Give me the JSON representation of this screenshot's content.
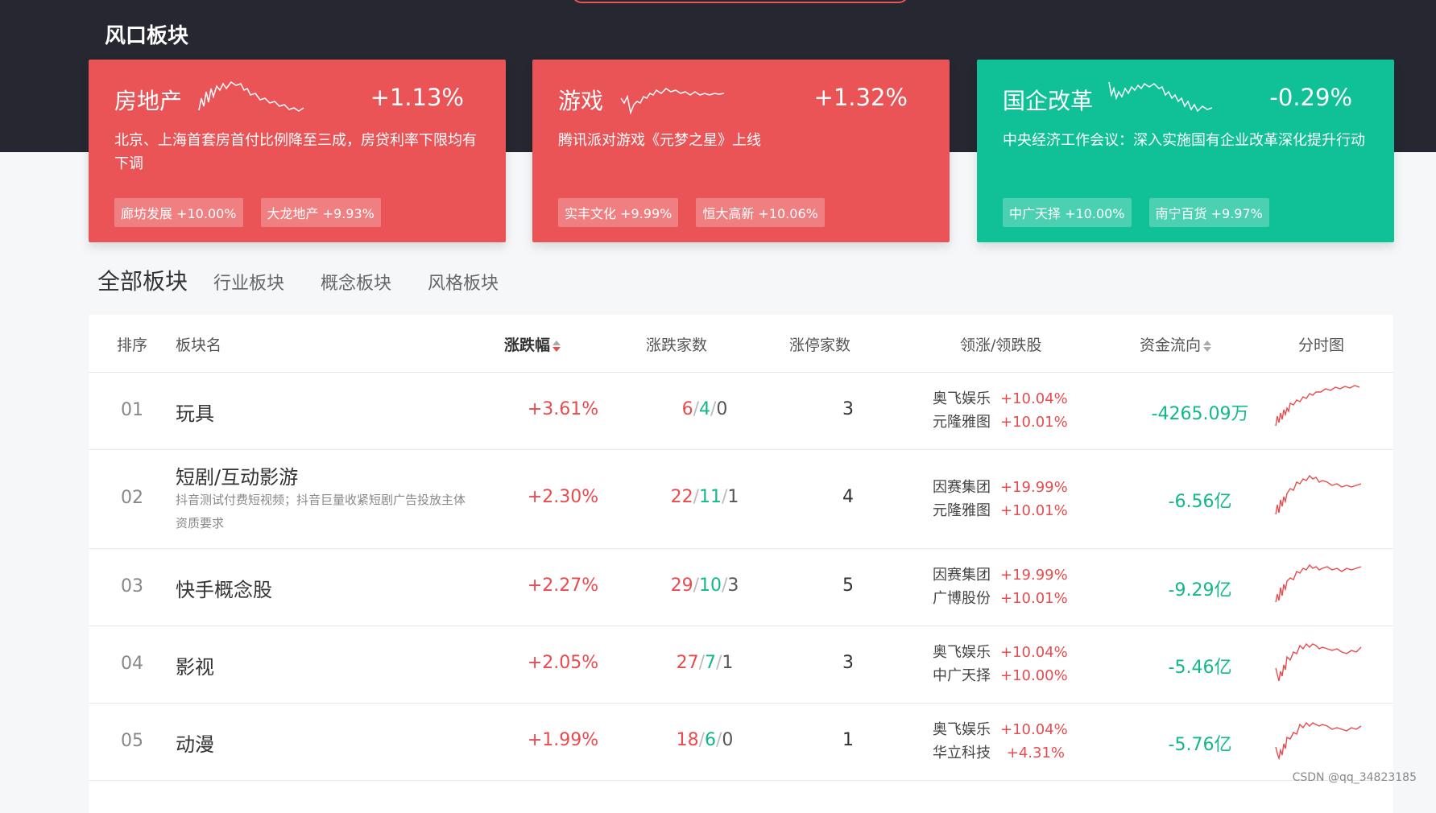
{
  "header": {
    "title": "风口板块"
  },
  "cards": [
    {
      "name": "房地产",
      "pct": "+1.13%",
      "desc": "北京、上海首套房首付比例降至三成，房贷利率下限均有下调",
      "tags": [
        "廊坊发展 +10.00%",
        "大龙地产 +9.93%"
      ],
      "color": "#ea5456"
    },
    {
      "name": "游戏",
      "pct": "+1.32%",
      "desc": "腾讯派对游戏《元梦之星》上线",
      "tags": [
        "实丰文化 +9.99%",
        "恒大高新 +10.06%"
      ],
      "color": "#ea5456"
    },
    {
      "name": "国企改革",
      "pct": "-0.29%",
      "desc": "中央经济工作会议：深入实施国有企业改革深化提升行动",
      "tags": [
        "中广天择 +10.00%",
        "南宁百货 +9.97%"
      ],
      "color": "#10c198"
    }
  ],
  "tabs": [
    "全部板块",
    "行业板块",
    "概念板块",
    "风格板块"
  ],
  "table": {
    "headers": {
      "rank": "排序",
      "name": "板块名",
      "chg": "涨跌幅",
      "ud": "涨跌家数",
      "zt": "涨停家数",
      "lead": "领涨/领跌股",
      "flow": "资金流向",
      "chart": "分时图"
    },
    "rows": [
      {
        "rank": "01",
        "name": "玩具",
        "sub": "",
        "chg": "+3.61%",
        "up": "6",
        "down": "4",
        "flat": "0",
        "zt": "3",
        "lead": [
          {
            "n": "奥飞娱乐",
            "p": "+10.04%"
          },
          {
            "n": "元隆雅图",
            "p": "+10.01%"
          }
        ],
        "flow": "-4265.09万"
      },
      {
        "rank": "02",
        "name": "短剧/互动影游",
        "sub": "抖音测试付费短视频；抖音巨量收紧短剧广告投放主体资质要求",
        "chg": "+2.30%",
        "up": "22",
        "down": "11",
        "flat": "1",
        "zt": "4",
        "lead": [
          {
            "n": "因赛集团",
            "p": "+19.99%"
          },
          {
            "n": "元隆雅图",
            "p": "+10.01%"
          }
        ],
        "flow": "-6.56亿"
      },
      {
        "rank": "03",
        "name": "快手概念股",
        "sub": "",
        "chg": "+2.27%",
        "up": "29",
        "down": "10",
        "flat": "3",
        "zt": "5",
        "lead": [
          {
            "n": "因赛集团",
            "p": "+19.99%"
          },
          {
            "n": "广博股份",
            "p": "+10.01%"
          }
        ],
        "flow": "-9.29亿"
      },
      {
        "rank": "04",
        "name": "影视",
        "sub": "",
        "chg": "+2.05%",
        "up": "27",
        "down": "7",
        "flat": "1",
        "zt": "3",
        "lead": [
          {
            "n": "奥飞娱乐",
            "p": "+10.04%"
          },
          {
            "n": "中广天择",
            "p": "+10.00%"
          }
        ],
        "flow": "-5.46亿"
      },
      {
        "rank": "05",
        "name": "动漫",
        "sub": "",
        "chg": "+1.99%",
        "up": "18",
        "down": "6",
        "flat": "0",
        "zt": "1",
        "lead": [
          {
            "n": "奥飞娱乐",
            "p": "+10.04%"
          },
          {
            "n": "华立科技",
            "p": "+4.31%"
          }
        ],
        "flow": "-5.76亿"
      }
    ]
  },
  "watermark": "CSDN @qq_34823185"
}
